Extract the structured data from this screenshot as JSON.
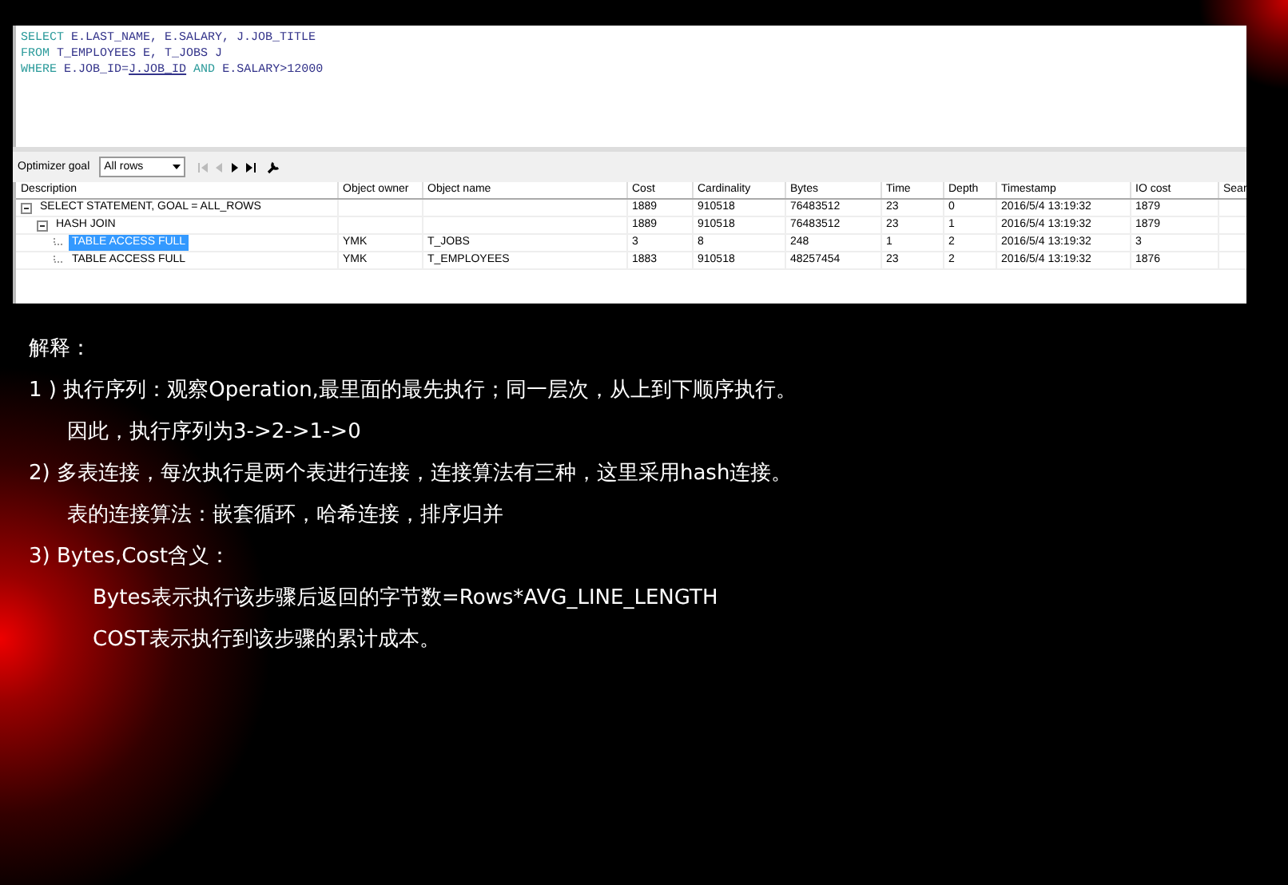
{
  "sql_editor": {
    "lines": [
      [
        {
          "kind": "keyword",
          "text": "SELECT"
        },
        {
          "kind": "text",
          "text": " E.LAST_NAME, E.SALARY, J.JOB_TITLE"
        }
      ],
      [
        {
          "kind": "keyword",
          "text": "FROM"
        },
        {
          "kind": "text",
          "text": " T_EMPLOYEES E, T_JOBS J"
        }
      ],
      [
        {
          "kind": "keyword",
          "text": "WHERE"
        },
        {
          "kind": "text",
          "text": " E.JOB_ID="
        },
        {
          "kind": "link",
          "text": "J.JOB_ID"
        },
        {
          "kind": "keyword",
          "text": " AND"
        },
        {
          "kind": "text",
          "text": " E.SALARY>12000"
        }
      ]
    ]
  },
  "toolbar": {
    "label": "Optimizer goal",
    "select": "All rows",
    "buttons": [
      {
        "kind": "first",
        "disabled": true
      },
      {
        "kind": "prev",
        "disabled": true
      },
      {
        "kind": "next",
        "disabled": false
      },
      {
        "kind": "last",
        "disabled": false
      },
      {
        "kind": "wrench",
        "disabled": false
      }
    ]
  },
  "plan": {
    "columns": [
      "Description",
      "Object owner",
      "Object name",
      "Cost",
      "Cardinality",
      "Bytes",
      "Time",
      "Depth",
      "Timestamp",
      "IO cost",
      "Sear"
    ],
    "rows": [
      {
        "cells": [
          "SELECT STATEMENT, GOAL = ALL_ROWS",
          "",
          "",
          "1889",
          "910518",
          "76483512",
          "23",
          "0",
          "2016/5/4 13:19:32",
          "1879",
          ""
        ],
        "selected": false,
        "expanded": true,
        "children": [
          {
            "cells": [
              "HASH JOIN",
              "",
              "",
              "1889",
              "910518",
              "76483512",
              "23",
              "1",
              "2016/5/4 13:19:32",
              "1879",
              ""
            ],
            "selected": false,
            "expanded": true,
            "children": [
              {
                "cells": [
                  "TABLE ACCESS FULL",
                  "YMK",
                  "T_JOBS",
                  "3",
                  "8",
                  "248",
                  "1",
                  "2",
                  "2016/5/4 13:19:32",
                  "3",
                  ""
                ],
                "selected": true
              },
              {
                "cells": [
                  "TABLE ACCESS FULL",
                  "YMK",
                  "T_EMPLOYEES",
                  "1883",
                  "910518",
                  "48257454",
                  "23",
                  "2",
                  "2016/5/4 13:19:32",
                  "1876",
                  ""
                ],
                "selected": false
              }
            ]
          }
        ]
      }
    ]
  },
  "notes": [
    {
      "text": "解释："
    },
    {
      "text": "1 ) 执行序列：观察Operation,最里面的最先执行；同一层次，从上到下顺序执行。",
      "children": [
        {
          "text": "因此，执行序列为3->2->1->0"
        }
      ]
    },
    {
      "text": "2) 多表连接，每次执行是两个表进行连接，连接算法有三种，这里采用hash连接。",
      "children": [
        {
          "text": "表的连接算法：嵌套循环，哈希连接，排序归并"
        }
      ]
    },
    {
      "text": "3) Bytes,Cost含义：",
      "children": [
        {
          "text": "Bytes表示执行该步骤后返回的字节数=Rows*AVG_LINE_LENGTH",
          "deep": true
        },
        {
          "text": "COST表示执行到该步骤的累计成本。",
          "deep": true
        }
      ]
    }
  ]
}
